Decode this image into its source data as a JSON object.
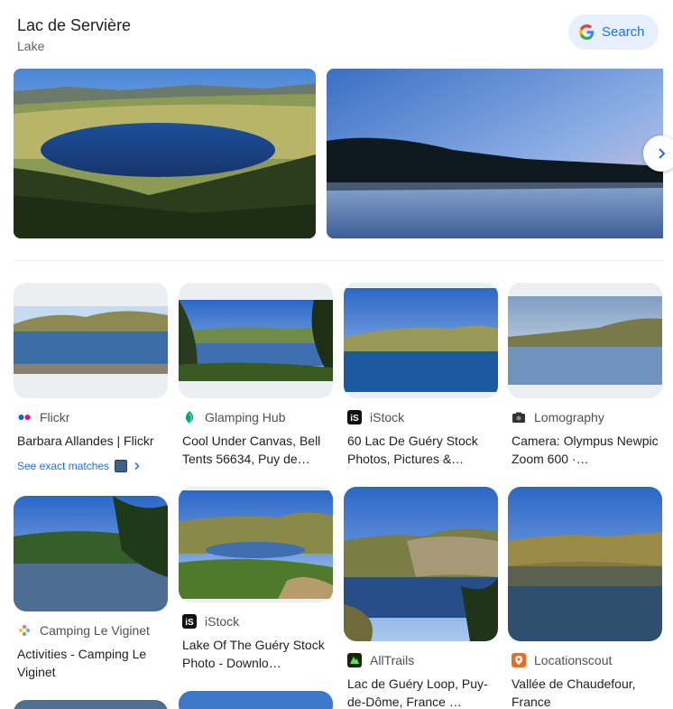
{
  "header": {
    "title": "Lac de Servière",
    "subtitle": "Lake",
    "search_label": "Search"
  },
  "results": [
    {
      "source": "Flickr",
      "title": "Barbara Allandes | Flickr",
      "extra": "See exact matches"
    },
    {
      "source": "Glamping Hub",
      "title": "Cool Under Canvas, Bell Tents 56634, Puy de…"
    },
    {
      "source": "iStock",
      "title": "60 Lac De Guéry Stock Photos, Pictures &…"
    },
    {
      "source": "Lomography",
      "title": "Camera: Olympus Newpic Zoom 600 ·…"
    },
    {
      "source": "Camping Le Viginet",
      "title": "Activities - Camping Le Viginet"
    },
    {
      "source": "iStock",
      "title": "Lake Of The Guéry Stock Photo - Downlo…"
    },
    {
      "source": "AllTrails",
      "title": "Lac de Guéry Loop, Puy-de-Dôme, France …"
    },
    {
      "source": "Locationscout",
      "title": "Vallée de Chaudefour, France"
    }
  ],
  "icons": {
    "google": "google-g-icon",
    "next": "chevron-right-icon",
    "flickr": "flickr-icon",
    "glamping": "glamping-hub-icon",
    "istock": "istock-icon",
    "lomography": "camera-icon",
    "camping": "camping-flower-icon",
    "alltrails": "alltrails-icon",
    "locationscout": "location-pin-icon"
  },
  "colors": {
    "accent": "#1a73e8",
    "search_bg": "#e8f0fe"
  }
}
